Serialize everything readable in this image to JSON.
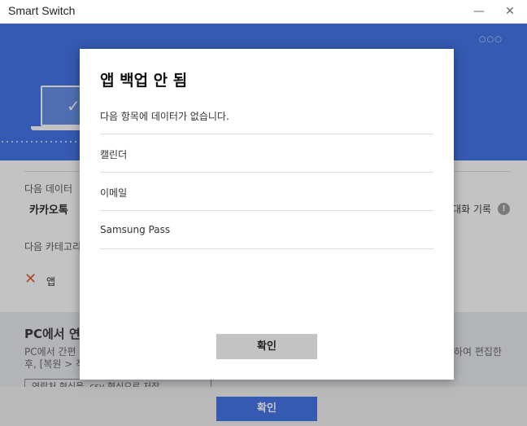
{
  "window": {
    "title": "Smart Switch",
    "minimize_glyph": "—",
    "close_glyph": "✕"
  },
  "header": {
    "menu_glyph": "○○○"
  },
  "background": {
    "next_data_label": "다음 데이터",
    "kakao_label": "카카오톡",
    "chat_history_label": "대화 기록",
    "next_category_label": "다음 카테고리",
    "app_label": "앱",
    "panel_title": "PC에서 연",
    "panel_text_line1": "PC에서 간편",
    "panel_text_line2": "후, [복원 > 적",
    "panel_text_right_line1": "하여 편집한",
    "panel_button_label": "연락처 형식을 .csv 형식으로 저장",
    "footer_button_label": "확인"
  },
  "modal": {
    "title": "앱 백업 안 됨",
    "subtitle": "다음 항목에 데이터가 없습니다.",
    "items": [
      "캘린더",
      "이메일",
      "Samsung Pass"
    ],
    "confirm_label": "확인"
  },
  "colors": {
    "accent": "#3a6ee6",
    "error_x": "#e05a2b",
    "modal_button": "#c3c3c3"
  }
}
